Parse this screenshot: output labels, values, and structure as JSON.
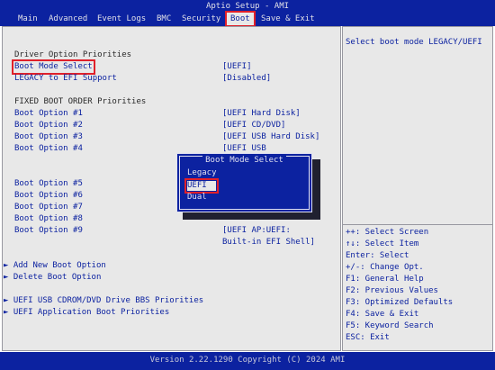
{
  "title": "Aptio Setup - AMI",
  "menu": [
    "Main",
    "Advanced",
    "Event Logs",
    "BMC",
    "Security",
    "Boot",
    "Save & Exit"
  ],
  "active_menu": "Boot",
  "sections": {
    "driver_option_heading": "Driver Option Priorities",
    "fixed_boot_heading": "FIXED BOOT ORDER Priorities"
  },
  "settings": [
    {
      "label": "Boot Mode Select",
      "value": "[UEFI]"
    },
    {
      "label": "LEGACY to EFI Support",
      "value": "[Disabled]"
    }
  ],
  "boot_options": [
    {
      "label": "Boot Option #1",
      "value": "[UEFI Hard Disk]"
    },
    {
      "label": "Boot Option #2",
      "value": "[UEFI CD/DVD]"
    },
    {
      "label": "Boot Option #3",
      "value": "[UEFI USB Hard Disk]"
    },
    {
      "label": "Boot Option #4",
      "value": "[UEFI USB"
    },
    {
      "label": "Boot Option #5",
      "value": ""
    },
    {
      "label": "Boot Option #6",
      "value": ""
    },
    {
      "label": "Boot Option #7",
      "value": ""
    },
    {
      "label": "Boot Option #8",
      "value": ""
    },
    {
      "label": "Boot Option #9",
      "value": "[UEFI AP:UEFI:",
      "value2": "Built-in EFI Shell]"
    }
  ],
  "links": [
    "Add New Boot Option",
    "Delete Boot Option",
    "UEFI USB CDROM/DVD Drive BBS Priorities",
    "UEFI Application Boot Priorities"
  ],
  "help_text": "Select boot mode LEGACY/UEFI",
  "keys": [
    "++: Select Screen",
    "↑↓: Select Item",
    "Enter: Select",
    "+/-: Change Opt.",
    "F1: General Help",
    "F2: Previous Values",
    "F3: Optimized Defaults",
    "F4: Save & Exit",
    "F5: Keyword Search",
    "ESC: Exit"
  ],
  "popup": {
    "title": "Boot Mode Select",
    "options": [
      "Legacy",
      "UEFI",
      "Dual"
    ],
    "selected": "UEFI"
  },
  "footer": "Version 2.22.1290 Copyright (C) 2024 AMI",
  "colors": {
    "title_bg": "#0c22a0",
    "panel_bg": "#e8e8e8",
    "text_blue": "#0c22a0",
    "highlight_red": "#e0202a"
  }
}
